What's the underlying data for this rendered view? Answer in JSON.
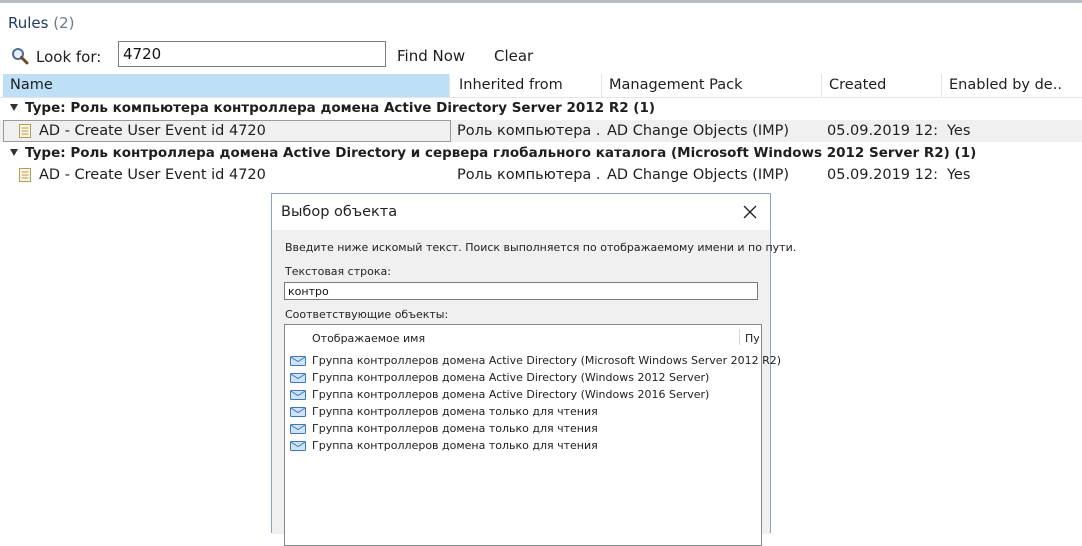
{
  "header": {
    "title": "Rules",
    "count": "(2)"
  },
  "search": {
    "look_for_label": "Look for:",
    "value": "4720",
    "find_now_label": "Find Now",
    "clear_label": "Clear"
  },
  "columns": [
    "Name",
    "Inherited from",
    "Management Pack",
    "Created",
    "Enabled by de..."
  ],
  "groups": [
    {
      "label": "Type: Роль компьютера контроллера домена Active Directory Server 2012 R2 (1)",
      "row": {
        "name": "AD - Create User Event id 4720",
        "inherited": "Роль компьютера ...",
        "mp": "AD Change Objects (IMP)",
        "created": "05.09.2019 12:...",
        "enabled": "Yes",
        "selected": true
      }
    },
    {
      "label": "Type: Роль контроллера домена Active Directory и сервера глобального каталога (Microsoft Windows 2012 Server R2) (1)",
      "row": {
        "name": "AD - Create User Event id 4720",
        "inherited": "Роль компьютера ...",
        "mp": "AD Change Objects (IMP)",
        "created": "05.09.2019 12:...",
        "enabled": "Yes",
        "selected": false
      }
    }
  ],
  "dialog": {
    "title": "Выбор объекта",
    "instruction": "Введите ниже искомый текст. Поиск выполняется по отображаемому имени и по пути.",
    "text_label": "Текстовая строка:",
    "text_value": "контро",
    "matching_label": "Соответствующие объекты:",
    "col_display_name": "Отображаемое имя",
    "col_path": "Пу",
    "items": [
      "Группа контроллеров домена Active Directory (Microsoft Windows Server 2012 R2)",
      "Группа контроллеров домена Active Directory (Windows 2012 Server)",
      "Группа контроллеров домена Active Directory (Windows 2016 Server)",
      "Группа контроллеров домена только для чтения",
      "Группа контроллеров домена только для чтения",
      "Группа контроллеров домена только для чтения"
    ]
  },
  "icons": {
    "search": "magnifier-icon",
    "rule": "document-icon",
    "group": "group-icon",
    "close": "close-icon",
    "expand": "collapse-triangle-icon"
  },
  "colors": {
    "selected_header": "#bde0f7",
    "title_text": "#1e3a5f",
    "selected_row": "#f0f0f0"
  }
}
